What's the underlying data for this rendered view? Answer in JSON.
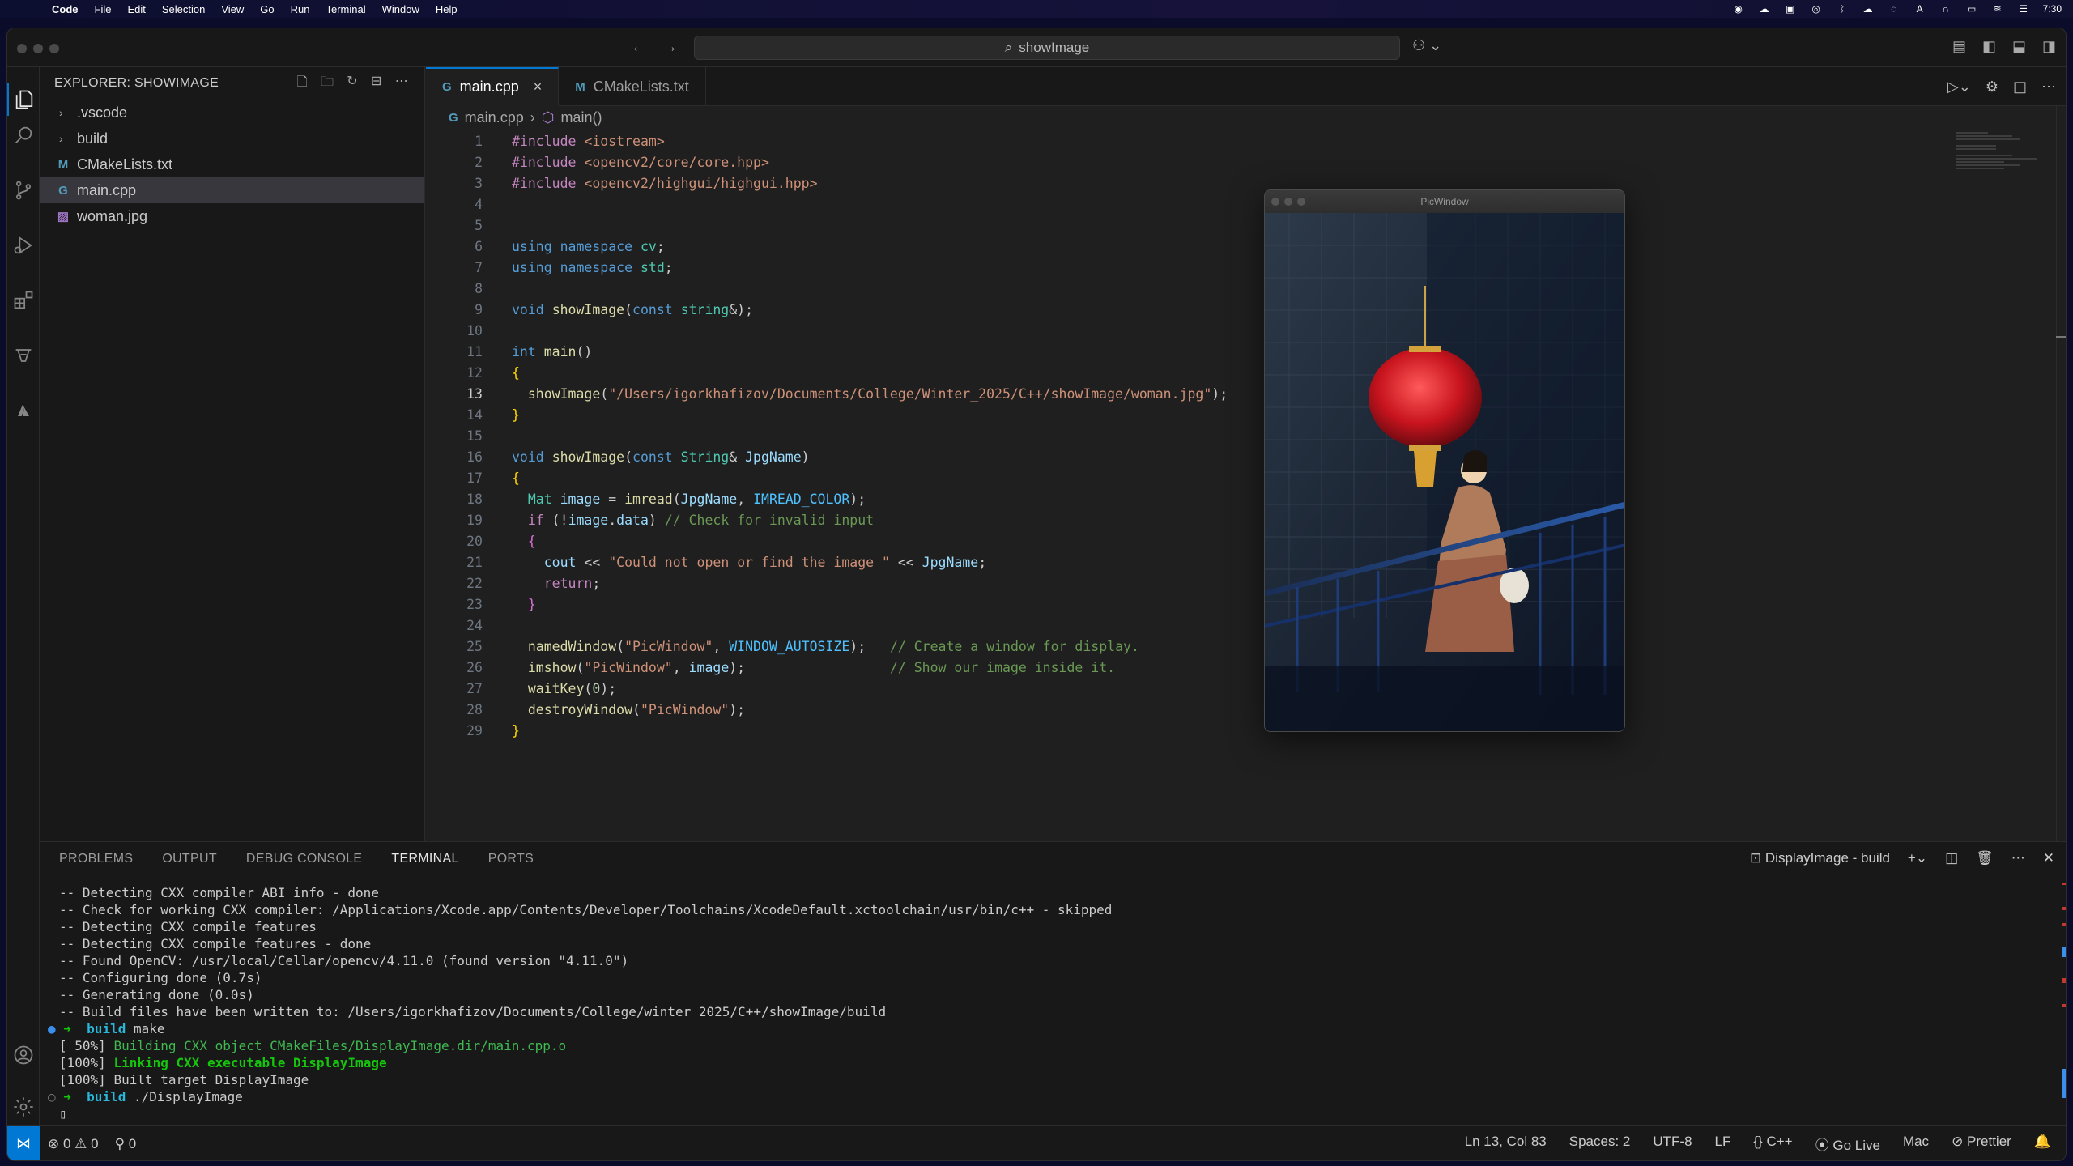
{
  "menubar": {
    "app": "Code",
    "items": [
      "File",
      "Edit",
      "Selection",
      "View",
      "Go",
      "Run",
      "Terminal",
      "Window",
      "Help"
    ],
    "clock": "7:30"
  },
  "titlebar": {
    "search_text": "showImage"
  },
  "sidebar": {
    "title": "EXPLORER: SHOWIMAGE",
    "items": [
      {
        "label": ".vscode",
        "type": "folder"
      },
      {
        "label": "build",
        "type": "folder"
      },
      {
        "label": "CMakeLists.txt",
        "type": "cmake"
      },
      {
        "label": "main.cpp",
        "type": "cpp"
      },
      {
        "label": "woman.jpg",
        "type": "image"
      }
    ]
  },
  "tabs": [
    {
      "label": "main.cpp",
      "icon": "cpp",
      "active": true
    },
    {
      "label": "CMakeLists.txt",
      "icon": "cmake",
      "active": false
    }
  ],
  "breadcrumb": {
    "file": "main.cpp",
    "symbol": "main()"
  },
  "editor": {
    "current_line": 13,
    "line_numbers": [
      "1",
      "2",
      "3",
      "4",
      "5",
      "6",
      "7",
      "8",
      "9",
      "10",
      "11",
      "12",
      "13",
      "14",
      "15",
      "16",
      "17",
      "18",
      "19",
      "20",
      "21",
      "22",
      "23",
      "24",
      "25",
      "26",
      "27",
      "28",
      "29"
    ]
  },
  "picwindow": {
    "title": "PicWindow"
  },
  "panel": {
    "tabs": [
      "PROBLEMS",
      "OUTPUT",
      "DEBUG CONSOLE",
      "TERMINAL",
      "PORTS"
    ],
    "active_tab": "TERMINAL",
    "terminal_name": "DisplayImage - build",
    "lines": [
      "-- Detecting CXX compiler ABI info - done",
      "-- Check for working CXX compiler: /Applications/Xcode.app/Contents/Developer/Toolchains/XcodeDefault.xctoolchain/usr/bin/c++ - skipped",
      "-- Detecting CXX compile features",
      "-- Detecting CXX compile features - done",
      "-- Found OpenCV: /usr/local/Cellar/opencv/4.11.0 (found version \"4.11.0\")",
      "-- Configuring done (0.7s)",
      "-- Generating done (0.0s)",
      "-- Build files have been written to: /Users/igorkhafizov/Documents/College/winter_2025/C++/showImage/build"
    ],
    "prompt1_dir": "build",
    "prompt1_cmd": "make",
    "build_lines": [
      {
        "prefix": "[ 50%] ",
        "text": "Building CXX object CMakeFiles/DisplayImage.dir/main.cpp.o"
      },
      {
        "prefix": "[100%] ",
        "text": "Linking CXX executable DisplayImage"
      },
      {
        "prefix": "[100%] ",
        "text": "Built target DisplayImage"
      }
    ],
    "prompt2_dir": "build",
    "prompt2_cmd": "./DisplayImage"
  },
  "statusbar": {
    "errors": "0",
    "warnings": "0",
    "ports": "0",
    "position": "Ln 13, Col 83",
    "spaces": "Spaces: 2",
    "encoding": "UTF-8",
    "eol": "LF",
    "language": "C++",
    "golive": "Go Live",
    "platform": "Mac",
    "prettier": "Prettier"
  },
  "colors": {
    "accent": "#0078d4",
    "background": "#1f1f1f",
    "sidebar": "#181818"
  },
  "icons": [
    "apple-logo",
    "explorer-icon",
    "search-icon",
    "source-control-icon",
    "run-debug-icon",
    "extensions-icon",
    "testing-icon",
    "cmake-icon",
    "account-icon",
    "settings-gear-icon"
  ]
}
